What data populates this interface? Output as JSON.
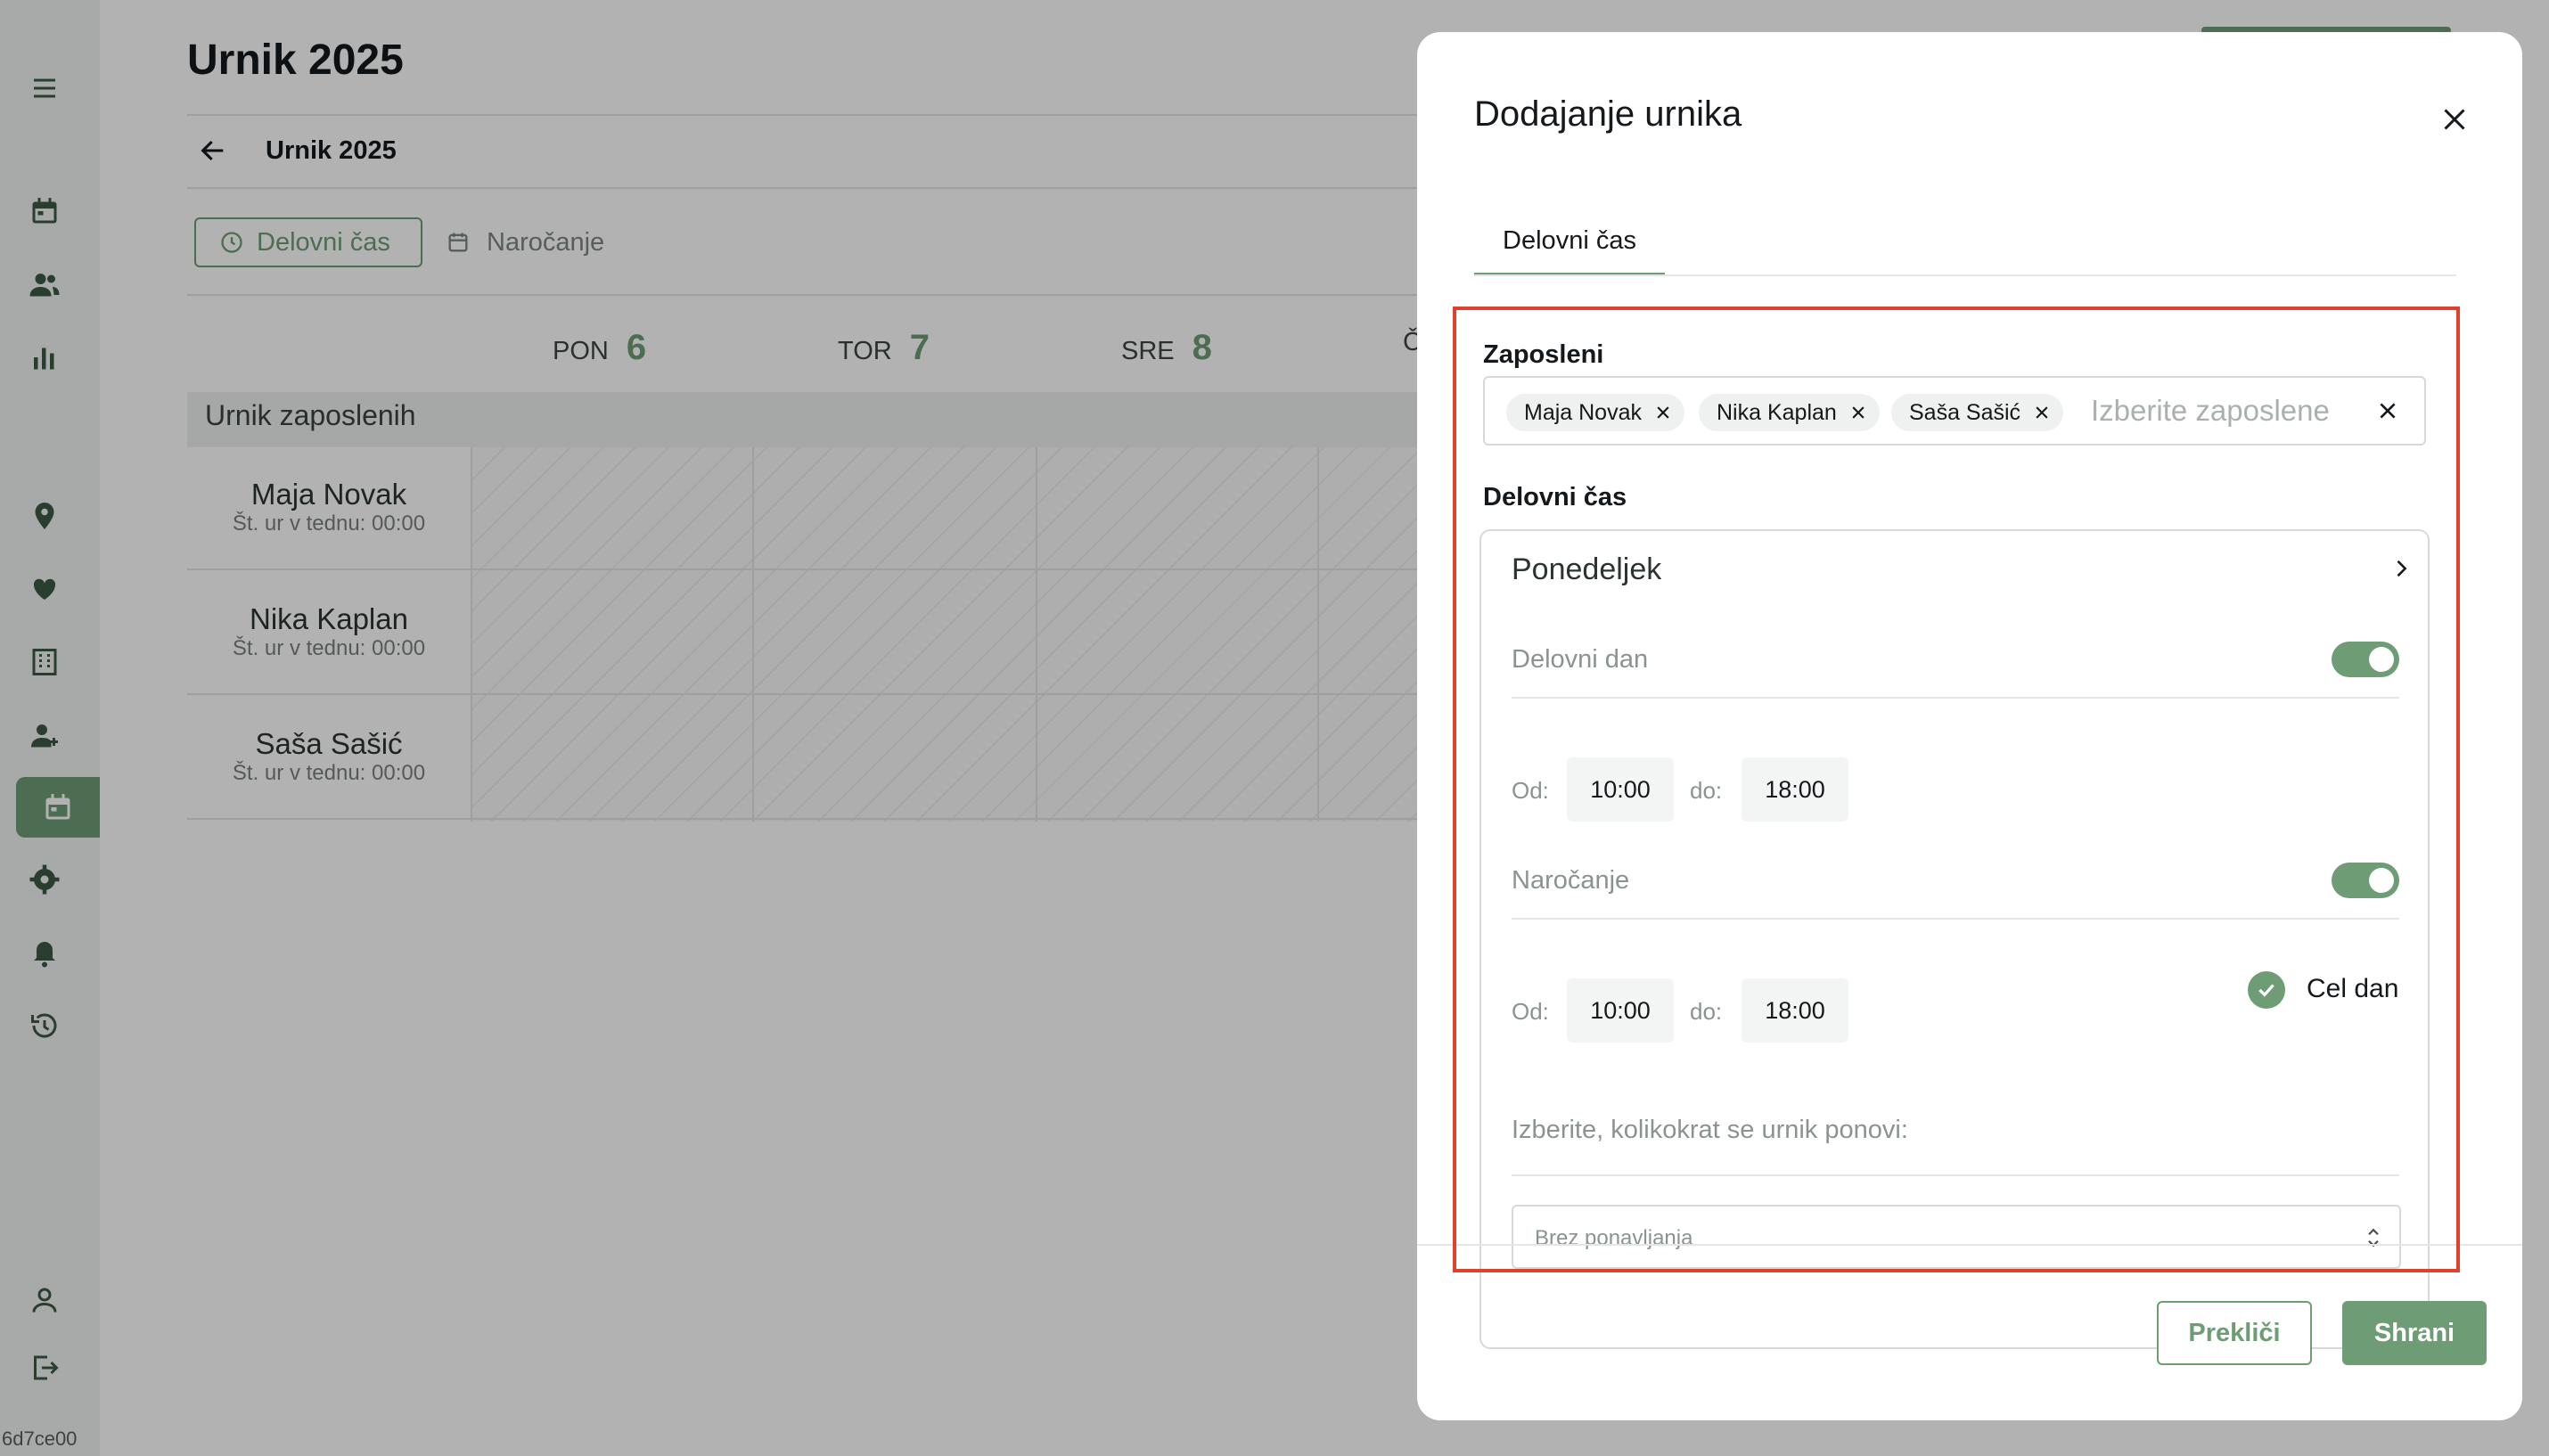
{
  "colors": {
    "accent": "#6e9c75",
    "highlight": "#e0412c",
    "overlay": "rgba(0,0,0,0.30)"
  },
  "sidebar": {
    "icons": [
      "menu-icon",
      "calendar-icon",
      "users-icon",
      "bar-chart-icon",
      "location-pin-icon",
      "heart-hand-icon",
      "building-icon",
      "add-user-icon",
      "schedule-icon",
      "settings-icon",
      "bell-icon",
      "history-icon",
      "profile-icon",
      "logout-icon"
    ],
    "active_icon": "schedule-icon",
    "build_id": "6d7ce00"
  },
  "page": {
    "title": "Urnik 2025",
    "breadcrumb": "Urnik 2025",
    "tabs": [
      {
        "label": "Delovni čas",
        "icon": "clock-icon",
        "active": true
      },
      {
        "label": "Naročanje",
        "icon": "calendar-icon",
        "active": false
      }
    ],
    "days": [
      {
        "name": "PON",
        "date": "6"
      },
      {
        "name": "TOR",
        "date": "7"
      },
      {
        "name": "SRE",
        "date": "8"
      },
      {
        "name": "Č",
        "date": ""
      }
    ],
    "section_label": "Urnik zaposlenih",
    "employees": [
      {
        "name": "Maja Novak",
        "hours": "Št. ur v tednu: 00:00"
      },
      {
        "name": "Nika Kaplan",
        "hours": "Št. ur v tednu: 00:00"
      },
      {
        "name": "Saša Sašić",
        "hours": "Št. ur v tednu: 00:00"
      }
    ]
  },
  "modal": {
    "title": "Dodajanje urnika",
    "tab": "Delovni čas",
    "employees_label": "Zaposleni",
    "selected_employees": [
      "Maja Novak",
      "Nika Kaplan",
      "Saša Sašić"
    ],
    "employees_placeholder": "Izberite zaposlene",
    "working_time_label": "Delovni čas",
    "day": {
      "name": "Ponedeljek",
      "working_day_label": "Delovni dan",
      "working_day_enabled": true,
      "from_label": "Od:",
      "to_label": "do:",
      "work_from": "10:00",
      "work_to": "18:00",
      "booking_label": "Naročanje",
      "booking_enabled": true,
      "booking_from": "10:00",
      "booking_to": "18:00",
      "all_day_label": "Cel dan",
      "all_day_checked": true,
      "repeat_label": "Izberite, kolikokrat se urnik ponovi:",
      "repeat_value": "Brez ponavljanja"
    },
    "cancel_label": "Prekliči",
    "save_label": "Shrani"
  }
}
